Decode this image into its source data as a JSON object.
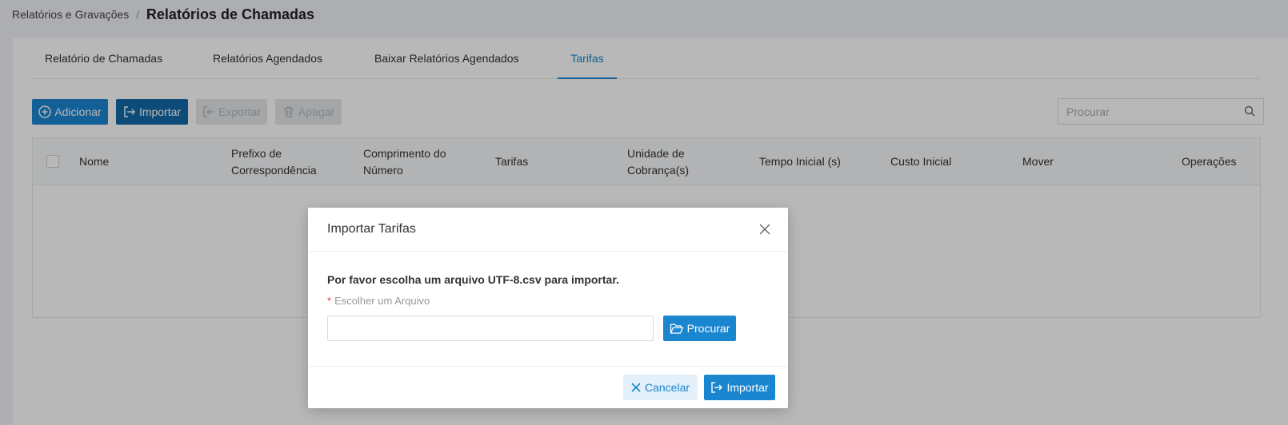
{
  "breadcrumb": {
    "parent": "Relatórios e Gravações",
    "separator": "/",
    "current": "Relatórios de Chamadas"
  },
  "tabs": [
    {
      "label": "Relatório de Chamadas",
      "active": false
    },
    {
      "label": "Relatórios Agendados",
      "active": false
    },
    {
      "label": "Baixar Relatórios Agendados",
      "active": false
    },
    {
      "label": "Tarifas",
      "active": true
    }
  ],
  "toolbar": {
    "add_label": "Adicionar",
    "import_label": "Importar",
    "export_label": "Exportar",
    "delete_label": "Apagar",
    "search_placeholder": "Procurar"
  },
  "table": {
    "columns": {
      "name": "Nome",
      "prefix_1": "Prefixo de",
      "prefix_2": "Correspondência",
      "length_1": "Comprimento do",
      "length_2": "Número",
      "rates": "Tarifas",
      "billing_1": "Unidade de",
      "billing_2": "Cobrança(s)",
      "initial_time": "Tempo Inicial (s)",
      "initial_cost": "Custo Inicial",
      "move": "Mover",
      "operations": "Operações"
    },
    "rows": []
  },
  "modal": {
    "title": "Importar Tarifas",
    "instruction": "Por favor escolha um arquivo UTF-8.csv para importar.",
    "required_mark": "*",
    "field_label": "Escolher um Arquivo",
    "file_value": "",
    "browse_label": "Procurar",
    "cancel_label": "Cancelar",
    "import_label": "Importar"
  },
  "colors": {
    "primary": "#1a86d0",
    "primary_dark": "#136aa8",
    "required": "#e53935"
  }
}
